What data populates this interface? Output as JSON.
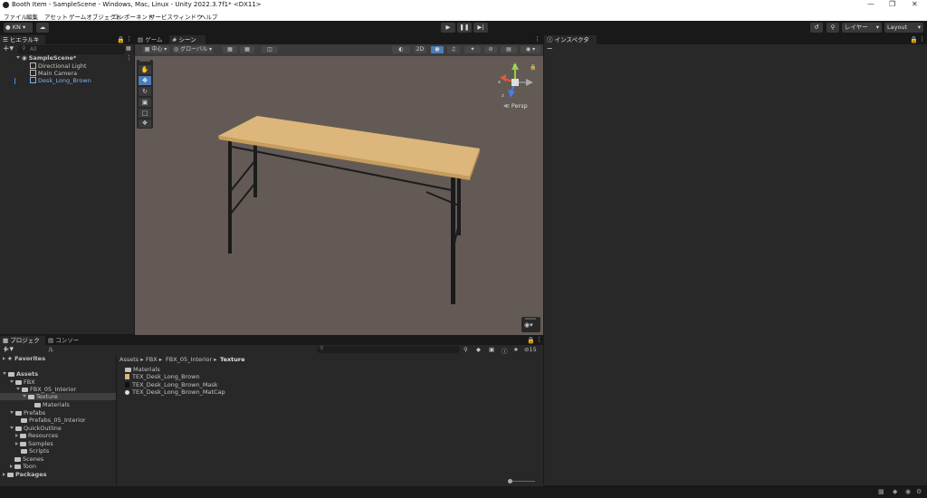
{
  "window": {
    "title": "Booth Item - SampleScene - Windows, Mac, Linux - Unity 2022.3.7f1* <DX11>"
  },
  "menu": [
    "ファイル",
    "編集",
    "アセット",
    "ゲームオブジェクト",
    "コンポーネント",
    "サービス",
    "ウィンドウ",
    "ヘルプ"
  ],
  "toolbar": {
    "account": "KN",
    "layers": "レイヤー",
    "layout": "Layout"
  },
  "hierarchy": {
    "tab": "ヒエラルキー",
    "search_placeholder": "All",
    "scene": "SampleScene*",
    "items": [
      "Directional Light",
      "Main Camera",
      "Desk_Long_Brown"
    ]
  },
  "scene_tabs": [
    "ゲーム",
    "シーン"
  ],
  "scene_toolbar": {
    "pivot": "中心",
    "space": "グローバル",
    "mode2d": "2D"
  },
  "gizmo": {
    "label": "Persp",
    "axes": [
      "y",
      "x",
      "z"
    ]
  },
  "inspector": {
    "tab": "インスペクター"
  },
  "project": {
    "tabs": [
      "プロジェクト",
      "コンソール"
    ],
    "favorites": "Favorites",
    "assets": "Assets",
    "tree": [
      "FBX",
      "FBX_05_Interior",
      "Texture",
      "Materials",
      "Prefabs",
      "Prefabs_05_Interior",
      "QuickOutline",
      "Resources",
      "Samples",
      "Scripts",
      "Scenes",
      "Toon"
    ],
    "packages": "Packages",
    "breadcrumb": [
      "Assets",
      "FBX",
      "FBX_05_Interior",
      "Texture"
    ],
    "files": [
      "Materials",
      "TEX_Desk_Long_Brown",
      "TEX_Desk_Long_Brown_Mask",
      "TEX_Desk_Long_Brown_MatCap"
    ],
    "hidden_count": "15"
  },
  "colors": {
    "desk_top": "#dcb67a",
    "desk_leg": "#1c1c1c",
    "scene_bg": "#635a55",
    "selected_text": "#7cb0ee"
  }
}
